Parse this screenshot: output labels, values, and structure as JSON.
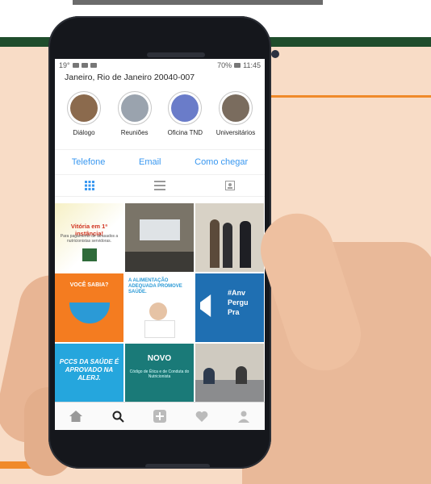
{
  "status_bar": {
    "left_text": "19°",
    "right_text": "70%",
    "time": "11:45"
  },
  "profile": {
    "address": "Janeiro, Rio de Janeiro 20040-007"
  },
  "highlights": [
    {
      "label": "Diálogo"
    },
    {
      "label": "Reuniões"
    },
    {
      "label": "Oficina TND"
    },
    {
      "label": "Universitários"
    }
  ],
  "contact_buttons": {
    "phone": "Telefone",
    "email": "Email",
    "directions": "Como chegar"
  },
  "posts": {
    "p1_title": "Vitória em 1ª instância!",
    "p1_sub": "Para pagamento de atrasados a nutricionistas servidoras.",
    "p4_title": "VOCÊ SABIA?",
    "p5_title": "A ALIMENTAÇÃO ADEQUADA PROMOVE SAÚDE.",
    "p6_title": "#Anv Pergu Pra",
    "p7_title": "PCCS DA SAÚDE É APROVADO NA ALERJ.",
    "p8_title": "NOVO",
    "p8_sub": "Código de Ética e de Conduta do Nutricionista"
  },
  "colors": {
    "accent": "#3897f0",
    "background": "#f8dcc6",
    "brand_green": "#1f4d2c",
    "deco_orange": "#f08a2a"
  },
  "icons": [
    "grid-icon",
    "list-icon",
    "tagged-icon",
    "home-icon",
    "search-icon",
    "add-icon",
    "heart-icon",
    "profile-icon"
  ]
}
